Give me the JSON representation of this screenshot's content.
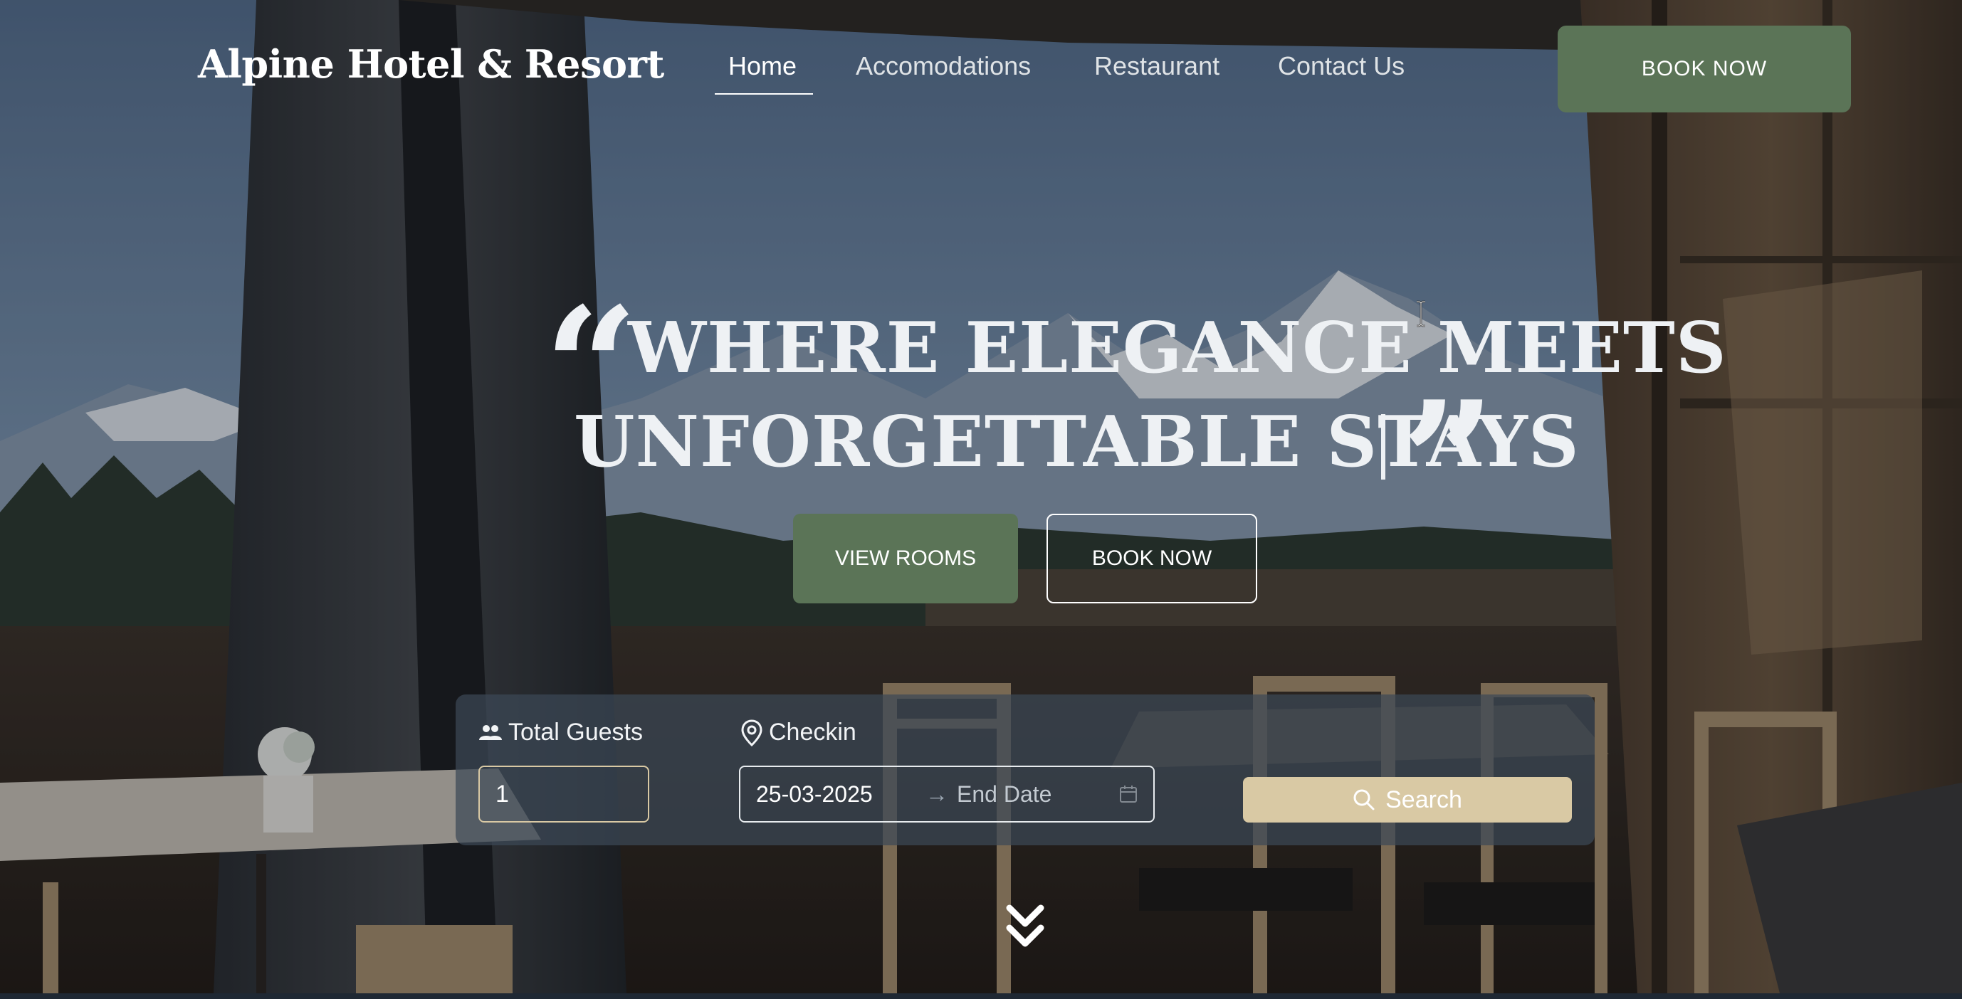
{
  "brand": {
    "name": "Alpine Hotel & Resort"
  },
  "nav": {
    "items": [
      {
        "label": "Home",
        "active": true
      },
      {
        "label": "Accomodations",
        "active": false
      },
      {
        "label": "Restaurant",
        "active": false
      },
      {
        "label": "Contact Us",
        "active": false
      }
    ],
    "book_label": "BOOK NOW"
  },
  "hero": {
    "headline_line1": "WHERE ELEGANCE MEETS",
    "headline_line2": "UNFORGETTABLE STAYS",
    "view_rooms_label": "VIEW ROOMS",
    "book_now_label": "BOOK NOW"
  },
  "search": {
    "guests_label": "Total Guests",
    "guests_value": "1",
    "checkin_label": "Checkin",
    "start_date": "25-03-2025",
    "end_date_placeholder": "End Date",
    "button_label": "Search"
  },
  "icons": {
    "quote_open": "quote-open-icon",
    "quote_close": "quote-close-icon",
    "guests": "users-icon",
    "checkin": "location-pin-icon",
    "calendar": "calendar-icon",
    "search": "search-icon",
    "scroll": "chevron-double-down-icon"
  },
  "colors": {
    "accent_green": "#5b7457",
    "accent_sand": "#d9c9a4",
    "text_light": "#eef1f4",
    "panel": "#3c4856"
  }
}
